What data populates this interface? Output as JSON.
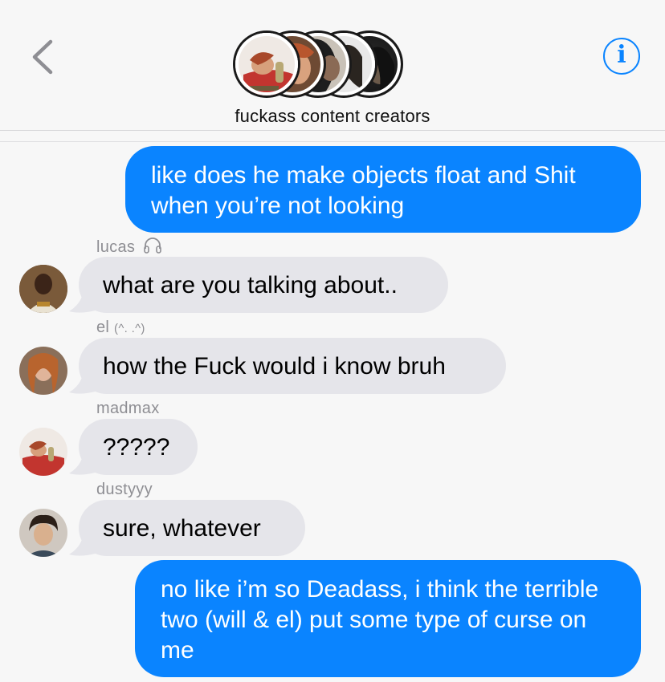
{
  "header": {
    "title": "fuckass content creators",
    "back_label": "‹",
    "info_label": "i"
  },
  "messages": [
    {
      "id": "m1",
      "direction": "outgoing",
      "text": "like does he make objects float and Shit when you’re not looking"
    },
    {
      "id": "m2",
      "direction": "incoming",
      "sender": "lucas",
      "sender_icon": "headphones-icon",
      "text": "what are you talking about.."
    },
    {
      "id": "m3",
      "direction": "incoming",
      "sender": "el",
      "sender_suffix": "(^. .^)",
      "text": "how the Fuck would i know bruh"
    },
    {
      "id": "m4",
      "direction": "incoming",
      "sender": "madmax",
      "text": "?????"
    },
    {
      "id": "m5",
      "direction": "incoming",
      "sender": "dustyyy",
      "text": "sure, whatever"
    },
    {
      "id": "m6",
      "direction": "outgoing",
      "text": "no like i’m so Deadass, i think the terrible two (will & el) put some type of curse on me"
    }
  ],
  "colors": {
    "outgoing_bubble": "#0a84ff",
    "incoming_bubble": "#e5e5ea",
    "accent": "#0a84ff",
    "sender_label": "#8e8e93"
  }
}
